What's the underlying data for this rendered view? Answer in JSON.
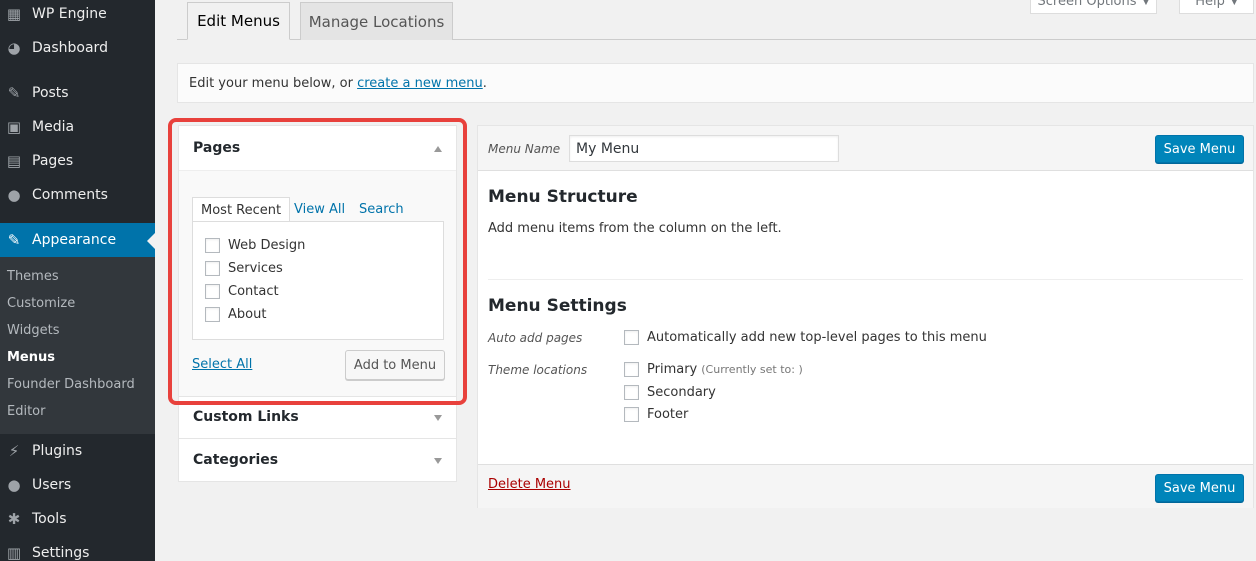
{
  "sidebar": {
    "site_name": "WP Engine",
    "items": [
      {
        "label": "Dashboard",
        "icon": "dashboard-icon"
      },
      {
        "label": "Posts",
        "icon": "pin-icon"
      },
      {
        "label": "Media",
        "icon": "media-icon"
      },
      {
        "label": "Pages",
        "icon": "pages-icon"
      },
      {
        "label": "Comments",
        "icon": "comment-icon"
      },
      {
        "label": "Appearance",
        "icon": "brush-icon"
      },
      {
        "label": "Plugins",
        "icon": "plugin-icon"
      },
      {
        "label": "Users",
        "icon": "user-icon"
      },
      {
        "label": "Tools",
        "icon": "wrench-icon"
      },
      {
        "label": "Settings",
        "icon": "settings-icon"
      }
    ],
    "submenu": [
      "Themes",
      "Customize",
      "Widgets",
      "Menus",
      "Founder Dashboard",
      "Editor"
    ],
    "accent": "#0073aa"
  },
  "top": {
    "screen_options": "Screen Options",
    "help": "Help"
  },
  "tabs": {
    "edit": "Edit Menus",
    "manage": "Manage Locations"
  },
  "manage": {
    "prefix": "Edit your menu below, or ",
    "link": "create a new menu",
    "suffix": "."
  },
  "pages_box": {
    "title": "Pages",
    "tabs": [
      "Most Recent",
      "View All",
      "Search"
    ],
    "items": [
      "Web Design",
      "Services",
      "Contact",
      "About"
    ],
    "select_all": "Select All",
    "add_button": "Add to Menu"
  },
  "custom_links": {
    "title": "Custom Links"
  },
  "categories": {
    "title": "Categories"
  },
  "menu": {
    "name_label": "Menu Name",
    "name_value": "My Menu",
    "save": "Save Menu",
    "structure_title": "Menu Structure",
    "structure_hint": "Add menu items from the column on the left.",
    "settings_title": "Menu Settings",
    "auto_add_label": "Auto add pages",
    "auto_add_option": "Automatically add new top-level pages to this menu",
    "theme_locations_label": "Theme locations",
    "locations": [
      "Primary",
      "Secondary",
      "Footer"
    ],
    "primary_note": "(Currently set to: )",
    "delete": "Delete Menu"
  }
}
